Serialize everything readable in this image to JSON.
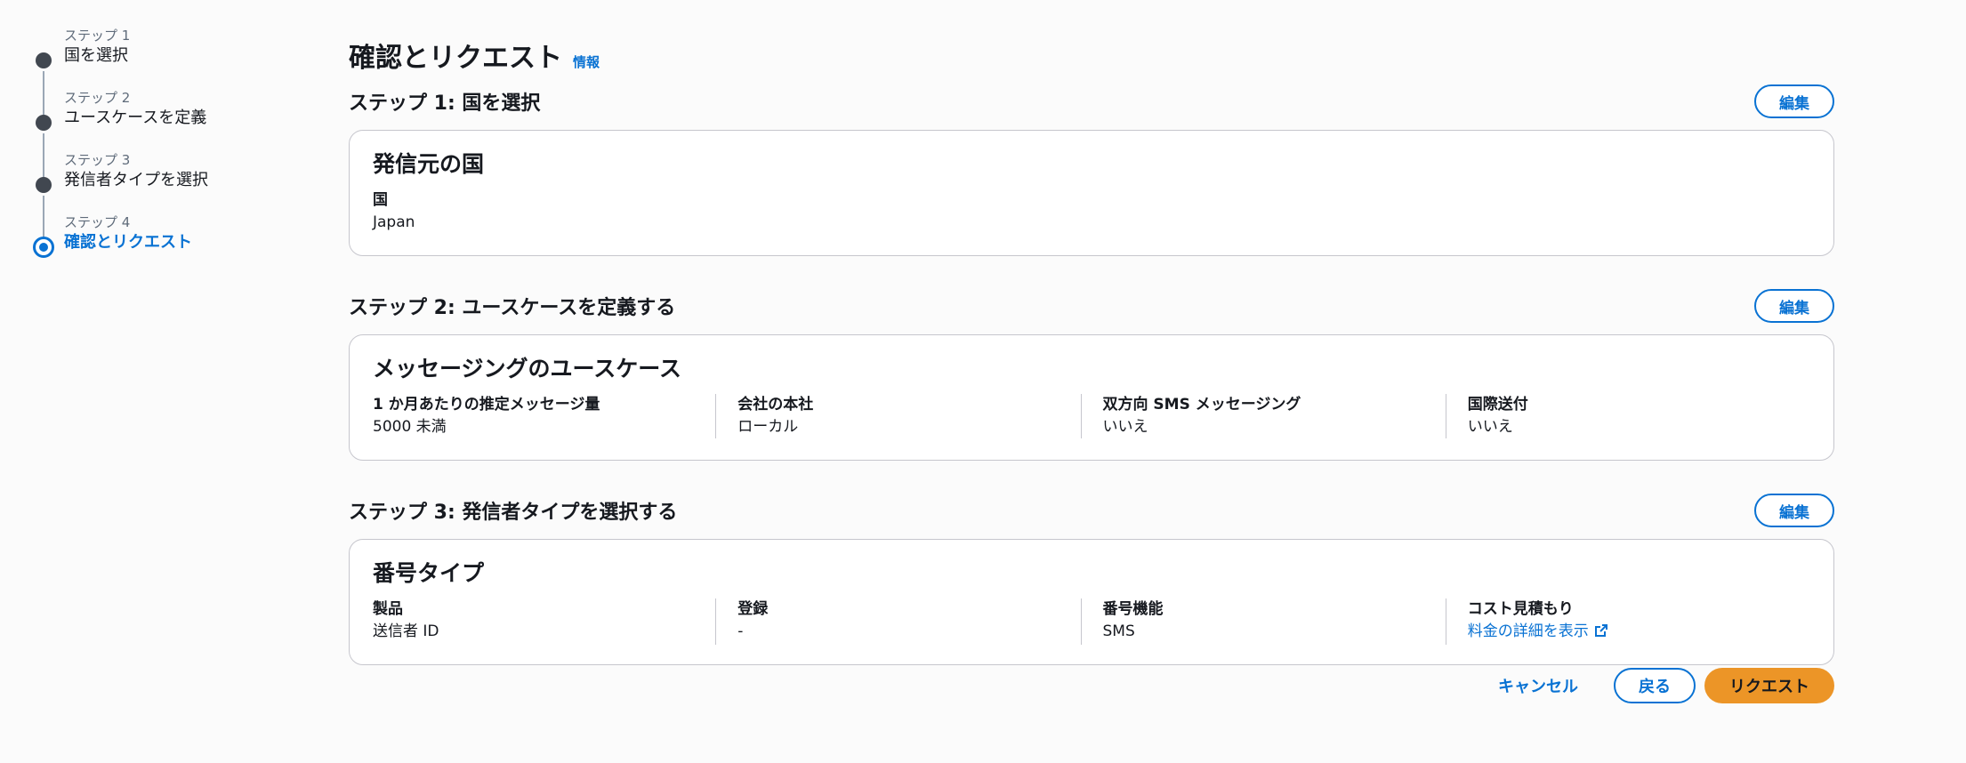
{
  "stepper": {
    "steps": [
      {
        "num": "ステップ 1",
        "title": "国を選択"
      },
      {
        "num": "ステップ 2",
        "title": "ユースケースを定義"
      },
      {
        "num": "ステップ 3",
        "title": "発信者タイプを選択"
      },
      {
        "num": "ステップ 4",
        "title": "確認とリクエスト"
      }
    ]
  },
  "header": {
    "title": "確認とリクエスト",
    "info": "情報"
  },
  "sections": [
    {
      "title": "ステップ 1: 国を選択",
      "edit": "編集",
      "card_title": "発信元の国",
      "fields": [
        {
          "label": "国",
          "value": "Japan"
        }
      ]
    },
    {
      "title": "ステップ 2: ユースケースを定義する",
      "edit": "編集",
      "card_title": "メッセージングのユースケース",
      "fields": [
        {
          "label": "1 か月あたりの推定メッセージ量",
          "value": "5000 未満"
        },
        {
          "label": "会社の本社",
          "value": "ローカル"
        },
        {
          "label": "双方向 SMS メッセージング",
          "value": "いいえ"
        },
        {
          "label": "国際送付",
          "value": "いいえ"
        }
      ]
    },
    {
      "title": "ステップ 3: 発信者タイプを選択する",
      "edit": "編集",
      "card_title": "番号タイプ",
      "fields": [
        {
          "label": "製品",
          "value": "送信者 ID"
        },
        {
          "label": "登録",
          "value": "-"
        },
        {
          "label": "番号機能",
          "value": "SMS"
        },
        {
          "label": "コスト見積もり",
          "value": "料金の詳細を表示"
        }
      ]
    }
  ],
  "footer": {
    "cancel": "キャンセル",
    "back": "戻る",
    "request": "リクエスト"
  },
  "colors": {
    "accent": "#0972d3",
    "primary_button": "#ec9527"
  },
  "icons": {
    "external_link": "external-link-icon"
  }
}
